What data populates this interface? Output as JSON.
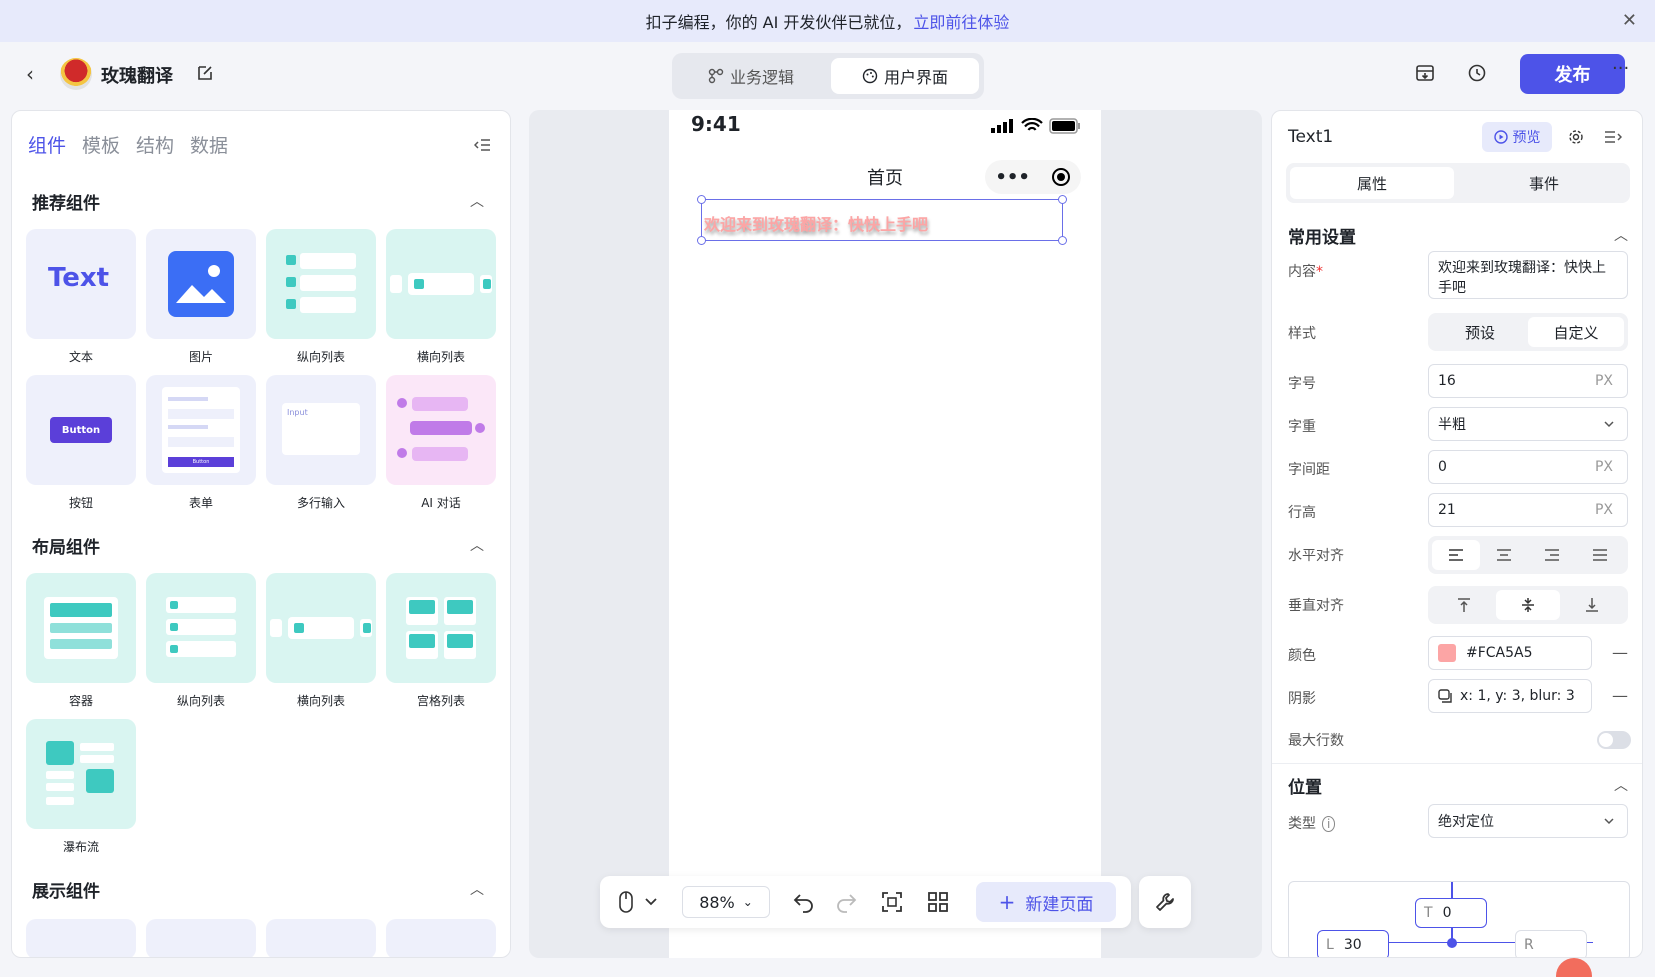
{
  "banner": {
    "text": "扣子编程，你的 AI 开发伙伴已就位，",
    "link": "立即前往体验",
    "close": "✕"
  },
  "header": {
    "app_name": "玫瑰翻译",
    "tabs": [
      {
        "label": "业务逻辑",
        "active": false
      },
      {
        "label": "用户界面",
        "active": true
      }
    ],
    "publish": "发布",
    "more": "···"
  },
  "left_panel": {
    "tabs": [
      "组件",
      "模板",
      "结构",
      "数据"
    ],
    "active_tab": "组件",
    "sections": [
      {
        "title": "推荐组件",
        "items": [
          "文本",
          "图片",
          "纵向列表",
          "横向列表",
          "按钮",
          "表单",
          "多行输入",
          "AI 对话"
        ]
      },
      {
        "title": "布局组件",
        "items": [
          "容器",
          "纵向列表",
          "横向列表",
          "宫格列表",
          "瀑布流"
        ]
      },
      {
        "title": "展示组件",
        "items": []
      }
    ],
    "tile_text": {
      "text": "Text",
      "button": "Button",
      "input": "Input",
      "form_button": "Button"
    }
  },
  "canvas": {
    "time": "9:41",
    "page_title": "首页",
    "selected_text": "欢迎来到玫瑰翻译：快快上手吧",
    "zoom": "88%",
    "new_page": "新建页面"
  },
  "right_panel": {
    "title": "Text1",
    "preview": "预览",
    "tabs": [
      "属性",
      "事件"
    ],
    "active_tab": "属性",
    "common_settings": "常用设置",
    "labels": {
      "content": "内容",
      "style": "样式",
      "font_size": "字号",
      "font_weight": "字重",
      "letter_spacing": "字间距",
      "line_height": "行高",
      "h_align": "水平对齐",
      "v_align": "垂直对齐",
      "color": "颜色",
      "shadow": "阴影",
      "max_lines": "最大行数"
    },
    "required_mark": "*",
    "content_value": "欢迎来到玫瑰翻译：快快上手吧",
    "style_options": [
      "预设",
      "自定义"
    ],
    "style_selected": "自定义",
    "font_size": "16",
    "font_weight": "半粗",
    "letter_spacing": "0",
    "line_height": "21",
    "unit": "PX",
    "color_value": "#FCA5A5",
    "shadow_value": "x: 1, y: 3, blur: 3",
    "max_lines_enabled": false,
    "position_title": "位置",
    "type_label": "类型",
    "type_value": "绝对定位",
    "pos_top_label": "T",
    "pos_top": "0",
    "pos_left_label": "L",
    "pos_left": "30",
    "pos_right_label": "R"
  },
  "colors": {
    "accent": "#4d53e8",
    "text_color": "#FCA5A5",
    "teal": "#3ec9c0"
  }
}
